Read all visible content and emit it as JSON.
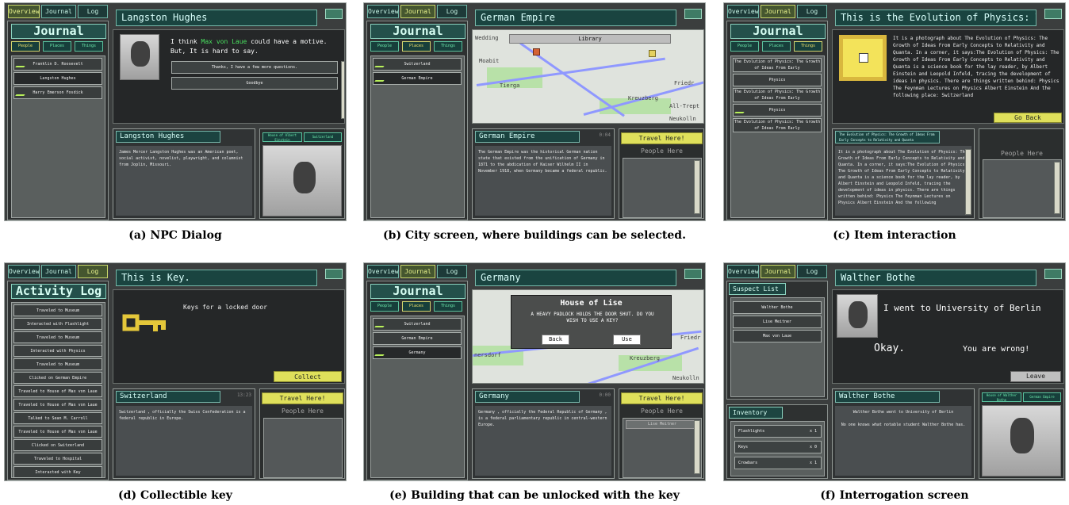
{
  "nav": [
    "Overview",
    "Journal",
    "Log"
  ],
  "captions": [
    "(a) NPC Dialog",
    "(b) City screen, where buildings can be selected.",
    "(c) Item interaction",
    "(d) Collectible key",
    "(e) Building that can be unlocked with the key",
    "(f) Interrogation screen"
  ],
  "shared": {
    "journal": "Journal",
    "people": "People",
    "places": "Places",
    "things": "Things",
    "travel": "Travel Here!",
    "people_here": "People Here",
    "go_back": "Go Back",
    "collect": "Collect",
    "leave": "Leave"
  },
  "panels": {
    "a": {
      "title": "Langston Hughes",
      "list": [
        "Franklin D. Roosevelt",
        "Langston Hughes",
        "Harry Emerson Fosdick"
      ],
      "dialog_pre": "I think",
      "dialog_name": "Max von Laue",
      "dialog_post": "could have a motive.",
      "dialog_line2": "But, It is hard to say.",
      "reply1": "Thanks, I have a few more questions.",
      "reply2": "Goodbye",
      "info_title": "Langston Hughes",
      "info_text": "James Mercer Langston Hughes  was an American poet, social activist, novelist, playwright, and columnist from Joplin, Missouri.",
      "tag1": "House of Albert Einstein",
      "tag2": "Switzerland"
    },
    "b": {
      "title": "German Empire",
      "banner": "Library",
      "list": [
        "Switzerland",
        "German Empire"
      ],
      "map_labels": [
        "Wedding",
        "Moabit",
        "Tierga",
        "Kreuzberg",
        "Friedr",
        "All-Trept",
        "Neukolln"
      ],
      "info_title": "German Empire",
      "time": "0:04",
      "info_text": "The German Empire  was the historical German nation state that existed from the unification of Germany in 1871 to the abdication of Kaiser Wilhelm II in November 1918, when Germany became a federal republic."
    },
    "c": {
      "title": "This is the Evolution of Physics: The",
      "text": "It is a photograph about The Evolution of Physics: The Growth of Ideas From Early Concepts to Relativity and Quanta. In a corner, it says:The Evolution of Physics: The Growth of Ideas From Early Concepts to Relativity and Quanta is a science book for the lay reader, by Albert Einstein and Leopold Infeld, tracing the development of ideas in physics.   There are things written behind: Physics The Feynman Lectures on Physics Albert Einstein  And the following place: Switzerland",
      "list": [
        "The Evolution of Physics: The Growth of Ideas From Early",
        "Physics",
        "The Evolution of Physics: The Growth of Ideas From Early",
        "Physics",
        "The Evolution of Physics: The Growth of Ideas From Early"
      ],
      "info_title": "The Evolution of Physics: The Growth of Ideas From Early Concepts to Relativity and Quanta",
      "info_text": "It is a photograph about The Evolution of Physics: The Growth of Ideas From Early Concepts to Relativity and Quanta. In a corner, it says:The Evolution of Physics: The Growth of Ideas From Early Concepts to Relativity and Quanta is a science book for the lay reader, by Albert Einstein and Leopold Infeld, tracing the development of ideas in physics.   There are things written behind: Physics The Feynman Lectures on Physics Albert Einstein  And the following"
    },
    "d": {
      "sidehead": "Activity Log",
      "title": "This is Key.",
      "key_text": "Keys for a locked door",
      "log": [
        "Traveled to Museum",
        "Interacted with Flashlight",
        "Traveled to Museum",
        "Interacted with Physics",
        "Traveled to Museum",
        "Clicked on German Empire",
        "Traveled to House of Max von Laue",
        "Traveled to House of Max von Laue",
        "Talked to Sean M. Carroll",
        "Traveled to House of Max von Laue",
        "Clicked on Switzerland",
        "Traveled to Hospital",
        "Interacted with Key"
      ],
      "info_title": "Switzerland",
      "time": "13:23",
      "info_text": "Switzerland , officially the Swiss Confederation is a federal republic in Europe."
    },
    "e": {
      "title": "Germany",
      "dialog_title": "House of Lise",
      "dialog_text": "A HEAVY PADLOCK HOLDS THE DOOR SHUT. DO YOU WISH TO USE A KEY?",
      "back": "Back",
      "use": "Use",
      "list": [
        "Switzerland",
        "German Empire",
        "Germany"
      ],
      "info_title": "Germany",
      "time": "0:00",
      "info_text": "Germany , officially the Federal Republic of Germany , is a federal parliamentary republic in central-western Europe.",
      "person": "Lise Meitner",
      "map_labels": [
        "nersdorf",
        "Kreuzberg",
        "Friedr",
        "Neukolln"
      ]
    },
    "f": {
      "suspect": "Suspect List",
      "suspects": [
        "Walther Bothe",
        "Lise Meitner",
        "Max von Laue"
      ],
      "title": "Walther Bothe",
      "line1": "I went to University of Berlin",
      "okay": "Okay.",
      "wrong": "You are wrong!",
      "info_title": "Walther Bothe",
      "info_text1": "Walther Bothe went to University of Berlin",
      "info_text2": "No one knows what notable student Walther Bothe has.",
      "tag1": "House of Walther Bothe",
      "tag2": "German Empire",
      "inventory": "Inventory",
      "items": [
        {
          "name": "Flashlights",
          "qty": "x 1"
        },
        {
          "name": "Keys",
          "qty": "x 0"
        },
        {
          "name": "Crowbars",
          "qty": "x 1"
        }
      ]
    }
  }
}
